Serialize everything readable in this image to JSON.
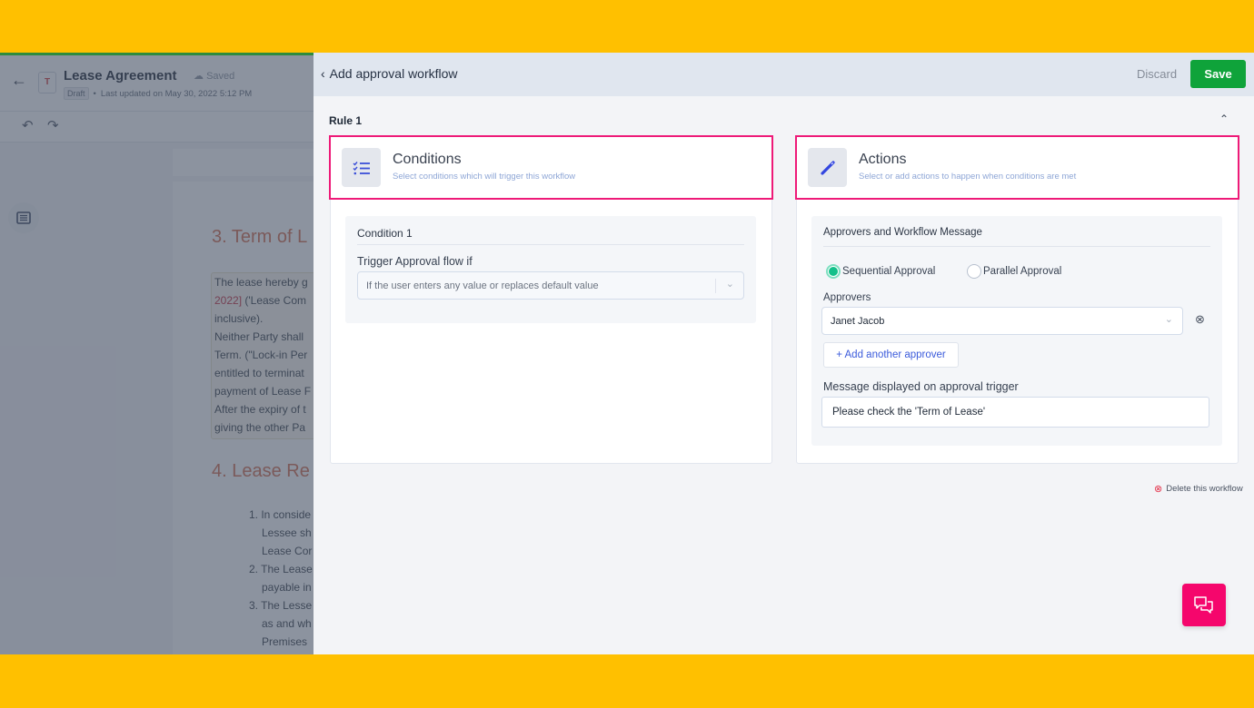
{
  "colors": {
    "background_frame": "#ffc000",
    "highlight_border": "#ee1a78",
    "save_button": "#0fa33a",
    "chat_button": "#f5066c",
    "radio_selected": "#13c08a",
    "link_blue": "#3b5bdb"
  },
  "editor": {
    "back_icon": "arrow-left-icon",
    "doc_icon_letter": "T",
    "doc_title": "Lease Agreement",
    "saved_status": "Saved",
    "status_badge": "Draft",
    "last_updated": "Last updated on May 30, 2022 5:12 PM",
    "undo_icon": "undo-icon",
    "redo_icon": "redo-icon",
    "outline_icon": "list-icon",
    "section3_heading": "3. Term of L",
    "section3_lines": [
      {
        "text": "The lease hereby g",
        "highlight": ""
      },
      {
        "text": " ('Lease Com",
        "highlight": "2022]"
      },
      {
        "text": "inclusive).",
        "highlight": ""
      },
      {
        "text": "Neither Party shall",
        "highlight": ""
      },
      {
        "text": "Term. (\"Lock-in Per",
        "highlight": ""
      },
      {
        "text": "entitled to terminat",
        "highlight": ""
      },
      {
        "text": "payment of Lease F",
        "highlight": ""
      },
      {
        "text": "After the expiry of t",
        "highlight": ""
      },
      {
        "text": "giving the other Pa",
        "highlight": ""
      }
    ],
    "section4_heading": "4. Lease Re",
    "section4_lines": [
      "1. In conside",
      "Lessee sh",
      "Lease Cor",
      "2. The Lease",
      "payable in",
      "3. The Lesse",
      "as and wh",
      "Premises"
    ]
  },
  "panel": {
    "back_label": "Add approval workflow",
    "discard_label": "Discard",
    "save_label": "Save",
    "rule_label": "Rule 1",
    "conditions": {
      "icon": "checklist-icon",
      "title": "Conditions",
      "subtitle": "Select conditions which will trigger this workflow",
      "condition_title": "Condition 1",
      "trigger_label": "Trigger Approval flow if",
      "trigger_value": "If the user enters any value or replaces default value"
    },
    "actions": {
      "icon": "pencil-icon",
      "title": "Actions",
      "subtitle": "Select or add actions to happen when conditions are met",
      "section_title": "Approvers and Workflow Message",
      "approval_modes": [
        {
          "label": "Sequential Approval",
          "selected": true
        },
        {
          "label": "Parallel Approval",
          "selected": false
        }
      ],
      "approvers_label": "Approvers",
      "approvers": [
        "Janet Jacob"
      ],
      "add_approver_label": "+ Add another approver",
      "message_label": "Message displayed on approval trigger",
      "message_value": "Please check the 'Term of Lease'"
    },
    "delete_workflow_label": "Delete this workflow",
    "chat_icon": "chat-icon"
  }
}
